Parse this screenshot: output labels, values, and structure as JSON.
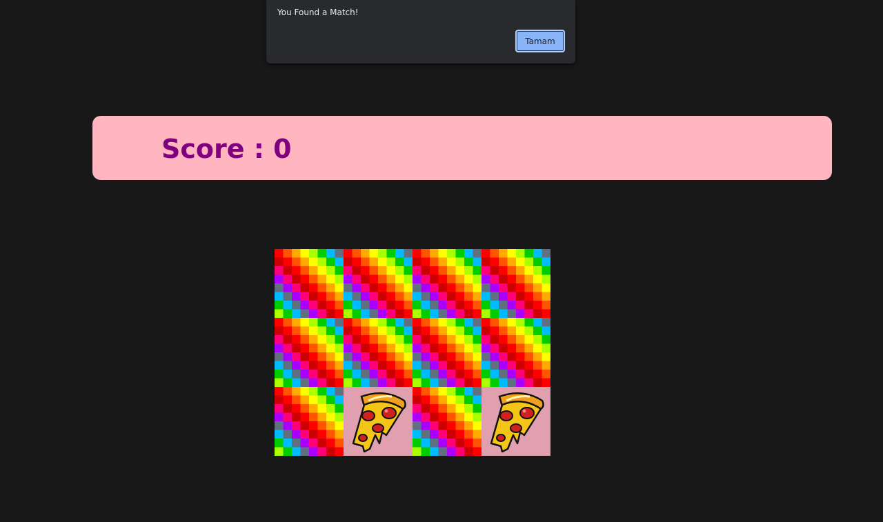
{
  "alert": {
    "message": "You Found a Match!",
    "ok_label": "Tamam"
  },
  "score": {
    "label": "Score : 0"
  },
  "board": {
    "rows": 3,
    "cols": 4,
    "cards": [
      {
        "state": "back"
      },
      {
        "state": "back"
      },
      {
        "state": "back"
      },
      {
        "state": "back"
      },
      {
        "state": "back"
      },
      {
        "state": "back"
      },
      {
        "state": "back"
      },
      {
        "state": "back"
      },
      {
        "state": "back"
      },
      {
        "state": "face",
        "icon": "pizza-slice-icon"
      },
      {
        "state": "back"
      },
      {
        "state": "face",
        "icon": "pizza-slice-icon"
      }
    ],
    "colors": {
      "face_background": "#e0a0b0",
      "checker_palette": [
        "#ff0000",
        "#ff5500",
        "#ffaa00",
        "#ffff00",
        "#aaff00",
        "#00cc00",
        "#00bbff",
        "#607080",
        "#aa00ff",
        "#ff0077",
        "#cc0000"
      ]
    }
  }
}
